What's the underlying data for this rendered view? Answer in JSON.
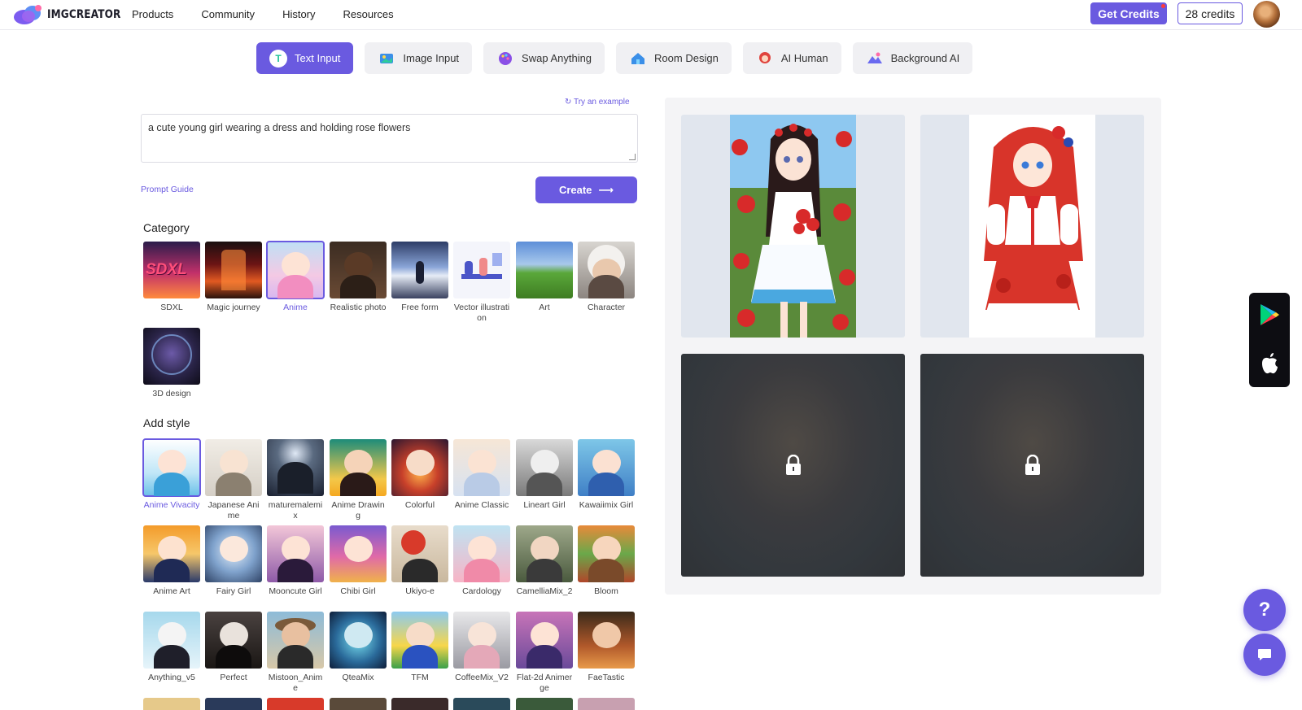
{
  "header": {
    "logo_text": "IMGCREATOR",
    "nav": [
      "Products",
      "Community",
      "History",
      "Resources"
    ],
    "get_credits_label": "Get Credits",
    "credits_label": "28 credits"
  },
  "tabs": [
    {
      "label": "Text Input",
      "active": true
    },
    {
      "label": "Image Input",
      "active": false
    },
    {
      "label": "Swap Anything",
      "active": false
    },
    {
      "label": "Room Design",
      "active": false
    },
    {
      "label": "AI Human",
      "active": false
    },
    {
      "label": "Background AI",
      "active": false
    }
  ],
  "prompt": {
    "try_example": "Try an example",
    "value": "a cute young girl wearing a dress and holding rose flowers",
    "guide_label": "Prompt Guide",
    "create_label": "Create"
  },
  "category": {
    "title": "Category",
    "items": [
      {
        "label": "SDXL",
        "badge_text": "SDXL",
        "selected": false
      },
      {
        "label": "Magic journey",
        "selected": false
      },
      {
        "label": "Anime",
        "selected": true
      },
      {
        "label": "Realistic photo",
        "selected": false
      },
      {
        "label": "Free form",
        "selected": false
      },
      {
        "label": "Vector illustration",
        "selected": false
      },
      {
        "label": "Art",
        "selected": false
      },
      {
        "label": "Character",
        "selected": false
      },
      {
        "label": "3D design",
        "selected": false
      }
    ]
  },
  "style": {
    "title": "Add style",
    "items": [
      {
        "label": "Anime Vivacity",
        "selected": true
      },
      {
        "label": "Japanese Anime",
        "selected": false
      },
      {
        "label": "maturemalemix",
        "selected": false
      },
      {
        "label": "Anime Drawing",
        "selected": false
      },
      {
        "label": "Colorful",
        "selected": false
      },
      {
        "label": "Anime Classic",
        "selected": false
      },
      {
        "label": "Lineart Girl",
        "selected": false
      },
      {
        "label": "Kawaiimix Girl",
        "selected": false
      },
      {
        "label": "Anime Art",
        "selected": false
      },
      {
        "label": "Fairy Girl",
        "selected": false
      },
      {
        "label": "Mooncute Girl",
        "selected": false
      },
      {
        "label": "Chibi Girl",
        "selected": false
      },
      {
        "label": "Ukiyo-e",
        "selected": false
      },
      {
        "label": "Cardology",
        "selected": false
      },
      {
        "label": "CamelliaMix_2",
        "selected": false
      },
      {
        "label": "Bloom",
        "selected": false
      },
      {
        "label": "Anything_v5",
        "selected": false
      },
      {
        "label": "Perfect",
        "selected": false
      },
      {
        "label": "Mistoon_Anime",
        "selected": false
      },
      {
        "label": "QteaMix",
        "selected": false
      },
      {
        "label": "TFM",
        "selected": false
      },
      {
        "label": "CoffeeMix_V2",
        "selected": false
      },
      {
        "label": "Flat-2d Animerge",
        "selected": false
      },
      {
        "label": "FaeTastic",
        "selected": false
      }
    ]
  },
  "preview": {
    "cards": [
      {
        "state": "generated",
        "icon": "anime-girl-white-dress-image"
      },
      {
        "state": "generated",
        "icon": "anime-girl-red-dress-image"
      },
      {
        "state": "locked",
        "icon": "lock-icon"
      },
      {
        "state": "locked",
        "icon": "lock-icon"
      }
    ]
  },
  "colors": {
    "accent": "#6a5ae0",
    "locked_overlay": "#3b3b3e",
    "preview_bg": "#e1e6ee"
  },
  "floating": {
    "help_label": "?",
    "app_store_icons": [
      "google-play-icon",
      "apple-icon"
    ]
  }
}
